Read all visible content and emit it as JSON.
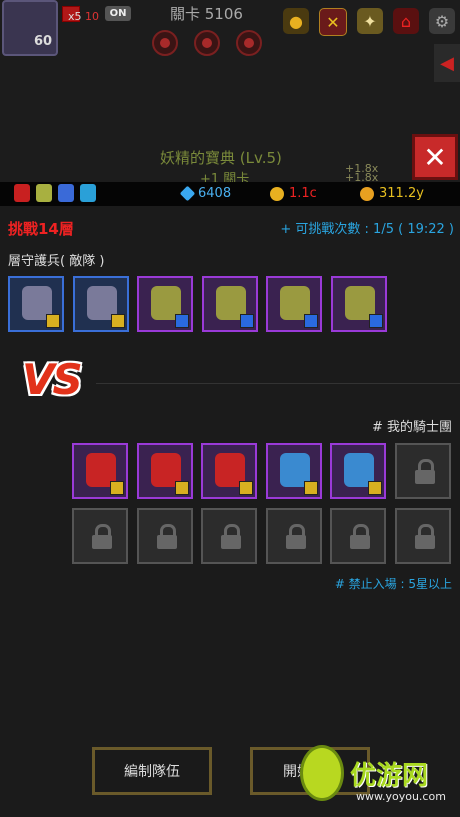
{
  "header": {
    "level": "60",
    "mini_count_prefix": "x5",
    "mini_count_red": "10",
    "toggle": "ON",
    "stage_title": "關卡 5106"
  },
  "book": {
    "title": "妖精的寶典 (Lv.5)",
    "subtitle": "+1 關卡",
    "mult1": "+1.8x",
    "mult2": "+1.8x"
  },
  "resources": {
    "gems": "6408",
    "medals": "1.1c",
    "gold": "311.2y"
  },
  "challenge": {
    "floor": "挑戰14層",
    "attempts": "+ 可挑戰次數 : 1/5 ( 19:22 )",
    "enemy_label": "層守護兵( 敵隊 )",
    "vs": "VS",
    "my_team_label": "# 我的騎士團",
    "restriction": "# 禁止入場 : 5星以上"
  },
  "enemy_team": [
    {
      "rarity": "blue",
      "tag": "gold",
      "sprite": "skeleton-flail-warrior"
    },
    {
      "rarity": "blue",
      "tag": "gold",
      "sprite": "skeleton-flail-warrior"
    },
    {
      "rarity": "purple",
      "tag": "blue",
      "sprite": "goblin-spearman"
    },
    {
      "rarity": "purple",
      "tag": "blue",
      "sprite": "goblin-spearman"
    },
    {
      "rarity": "purple",
      "tag": "blue",
      "sprite": "goblin-spearman"
    },
    {
      "rarity": "purple",
      "tag": "blue",
      "sprite": "goblin-spearman"
    }
  ],
  "my_team": [
    {
      "rarity": "purple",
      "tag": "gold",
      "sprite": "red-cavalry-knight"
    },
    {
      "rarity": "purple",
      "tag": "gold",
      "sprite": "red-cavalry-knight"
    },
    {
      "rarity": "purple",
      "tag": "gold",
      "sprite": "red-cavalry-knight"
    },
    {
      "rarity": "purple",
      "tag": "gold",
      "sprite": "blue-spiky-warrior"
    },
    {
      "rarity": "purple",
      "tag": "gold",
      "sprite": "blue-spiky-warrior"
    },
    {
      "rarity": "locked"
    },
    {
      "rarity": "locked"
    },
    {
      "rarity": "locked"
    },
    {
      "rarity": "locked"
    },
    {
      "rarity": "locked"
    },
    {
      "rarity": "locked"
    },
    {
      "rarity": "locked"
    }
  ],
  "buttons": {
    "edit_team": "編制隊伍",
    "start": "開始"
  },
  "watermark": {
    "text": "优游网",
    "url": "www.yoyou.com"
  },
  "colors": {
    "accent_red": "#e22222",
    "accent_blue": "#2aa5e0",
    "rare_blue": "#3a6fd8",
    "rare_purple": "#9a3ad8"
  }
}
